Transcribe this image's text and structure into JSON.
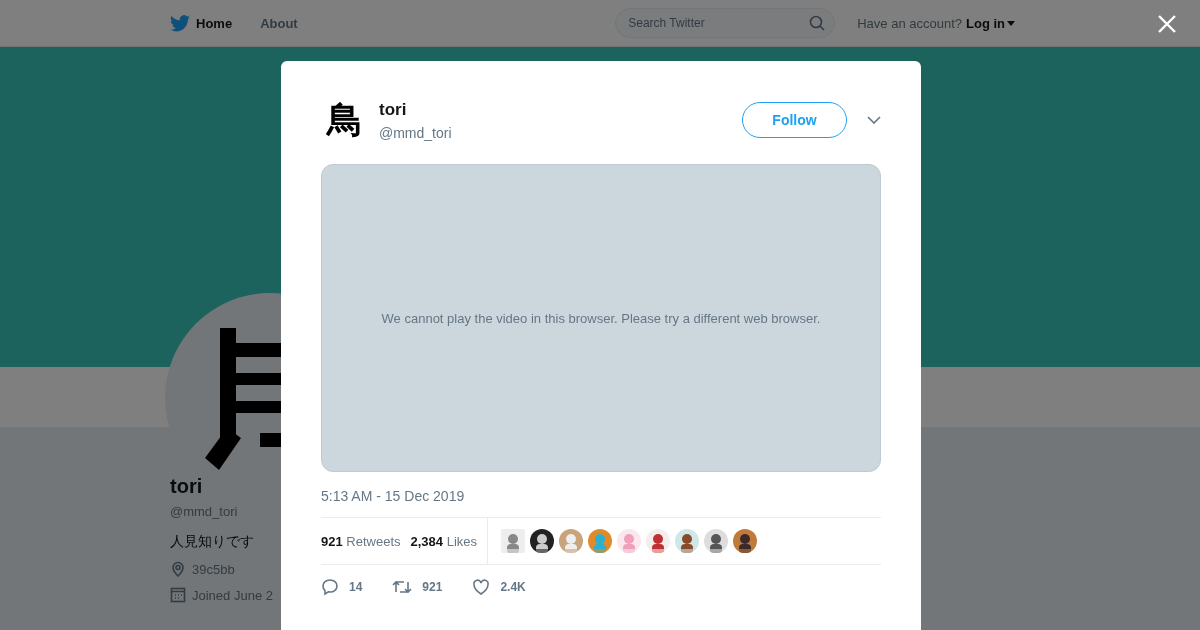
{
  "header": {
    "nav": [
      {
        "label": "Home",
        "selected": true
      },
      {
        "label": "About",
        "selected": false
      }
    ],
    "search": {
      "placeholder": "Search Twitter"
    },
    "account_prompt": "Have an account?",
    "login": "Log in"
  },
  "profile": {
    "name": "tori",
    "handle": "@mmd_tori",
    "bio": "人見知りです",
    "location": "39c5bb",
    "joined": "Joined June 2"
  },
  "tweet": {
    "avatar_char": "鳥",
    "name": "tori",
    "handle": "@mmd_tori",
    "follow": "Follow",
    "video_message": "We cannot play the video in this browser. Please try a different web browser.",
    "timestamp": "5:13 AM - 15 Dec 2019",
    "stats": [
      {
        "count": "921",
        "label": "Retweets"
      },
      {
        "count": "2,384",
        "label": "Likes"
      }
    ],
    "likers": [
      {
        "kind": "square"
      },
      {
        "kind": "round"
      },
      {
        "kind": "round"
      },
      {
        "kind": "round"
      },
      {
        "kind": "round"
      },
      {
        "kind": "round"
      },
      {
        "kind": "round"
      },
      {
        "kind": "round"
      },
      {
        "kind": "round"
      }
    ],
    "actions": [
      {
        "kind": "reply",
        "count": "14"
      },
      {
        "kind": "retweet",
        "count": "921"
      },
      {
        "kind": "like",
        "count": "2.4K"
      }
    ]
  }
}
